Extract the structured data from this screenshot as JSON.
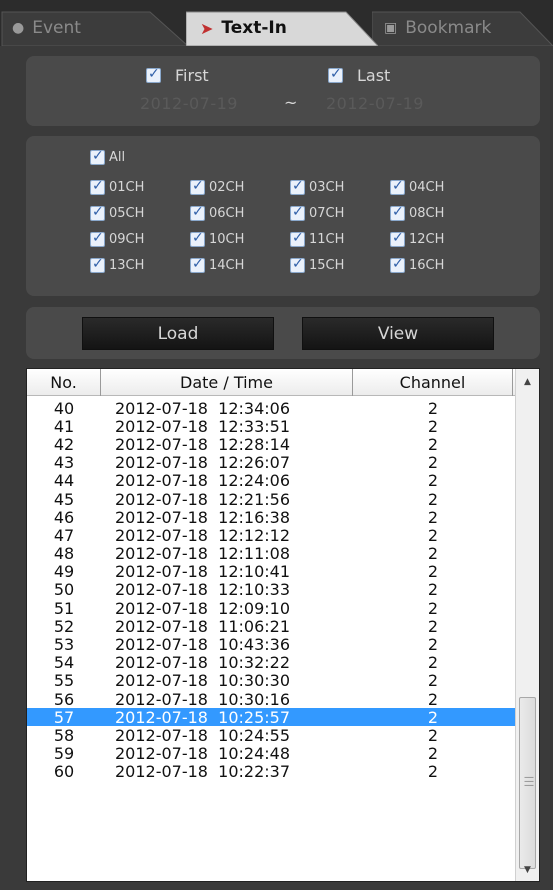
{
  "tabs": [
    {
      "label": "Event",
      "icon": "event-icon"
    },
    {
      "label": "Text-In",
      "icon": "text-in-icon"
    },
    {
      "label": "Bookmark",
      "icon": "bookmark-icon"
    }
  ],
  "date_range": {
    "first_label": "First",
    "last_label": "Last",
    "first_date": "2012-07-19",
    "separator": "~",
    "last_date": "2012-07-19"
  },
  "channels": {
    "all_label": "All",
    "items": [
      "01CH",
      "02CH",
      "03CH",
      "04CH",
      "05CH",
      "06CH",
      "07CH",
      "08CH",
      "09CH",
      "10CH",
      "11CH",
      "12CH",
      "13CH",
      "14CH",
      "15CH",
      "16CH"
    ]
  },
  "buttons": {
    "load": "Load",
    "view": "View"
  },
  "table": {
    "columns": [
      "No.",
      "Date / Time",
      "Channel"
    ],
    "selected_no": "57",
    "rows": [
      {
        "no": "40",
        "datetime": "2012-07-18  12:34:06",
        "channel": "2"
      },
      {
        "no": "41",
        "datetime": "2012-07-18  12:33:51",
        "channel": "2"
      },
      {
        "no": "42",
        "datetime": "2012-07-18  12:28:14",
        "channel": "2"
      },
      {
        "no": "43",
        "datetime": "2012-07-18  12:26:07",
        "channel": "2"
      },
      {
        "no": "44",
        "datetime": "2012-07-18  12:24:06",
        "channel": "2"
      },
      {
        "no": "45",
        "datetime": "2012-07-18  12:21:56",
        "channel": "2"
      },
      {
        "no": "46",
        "datetime": "2012-07-18  12:16:38",
        "channel": "2"
      },
      {
        "no": "47",
        "datetime": "2012-07-18  12:12:12",
        "channel": "2"
      },
      {
        "no": "48",
        "datetime": "2012-07-18  12:11:08",
        "channel": "2"
      },
      {
        "no": "49",
        "datetime": "2012-07-18  12:10:41",
        "channel": "2"
      },
      {
        "no": "50",
        "datetime": "2012-07-18  12:10:33",
        "channel": "2"
      },
      {
        "no": "51",
        "datetime": "2012-07-18  12:09:10",
        "channel": "2"
      },
      {
        "no": "52",
        "datetime": "2012-07-18  11:06:21",
        "channel": "2"
      },
      {
        "no": "53",
        "datetime": "2012-07-18  10:43:36",
        "channel": "2"
      },
      {
        "no": "54",
        "datetime": "2012-07-18  10:32:22",
        "channel": "2"
      },
      {
        "no": "55",
        "datetime": "2012-07-18  10:30:30",
        "channel": "2"
      },
      {
        "no": "56",
        "datetime": "2012-07-18  10:30:16",
        "channel": "2"
      },
      {
        "no": "57",
        "datetime": "2012-07-18  10:25:57",
        "channel": "2"
      },
      {
        "no": "58",
        "datetime": "2012-07-18  10:24:55",
        "channel": "2"
      },
      {
        "no": "59",
        "datetime": "2012-07-18  10:24:48",
        "channel": "2"
      },
      {
        "no": "60",
        "datetime": "2012-07-18  10:22:37",
        "channel": "2"
      }
    ]
  },
  "colors": {
    "selection": "#3399ff",
    "panel": "#4a4a4a",
    "background": "#3a3a3a"
  }
}
